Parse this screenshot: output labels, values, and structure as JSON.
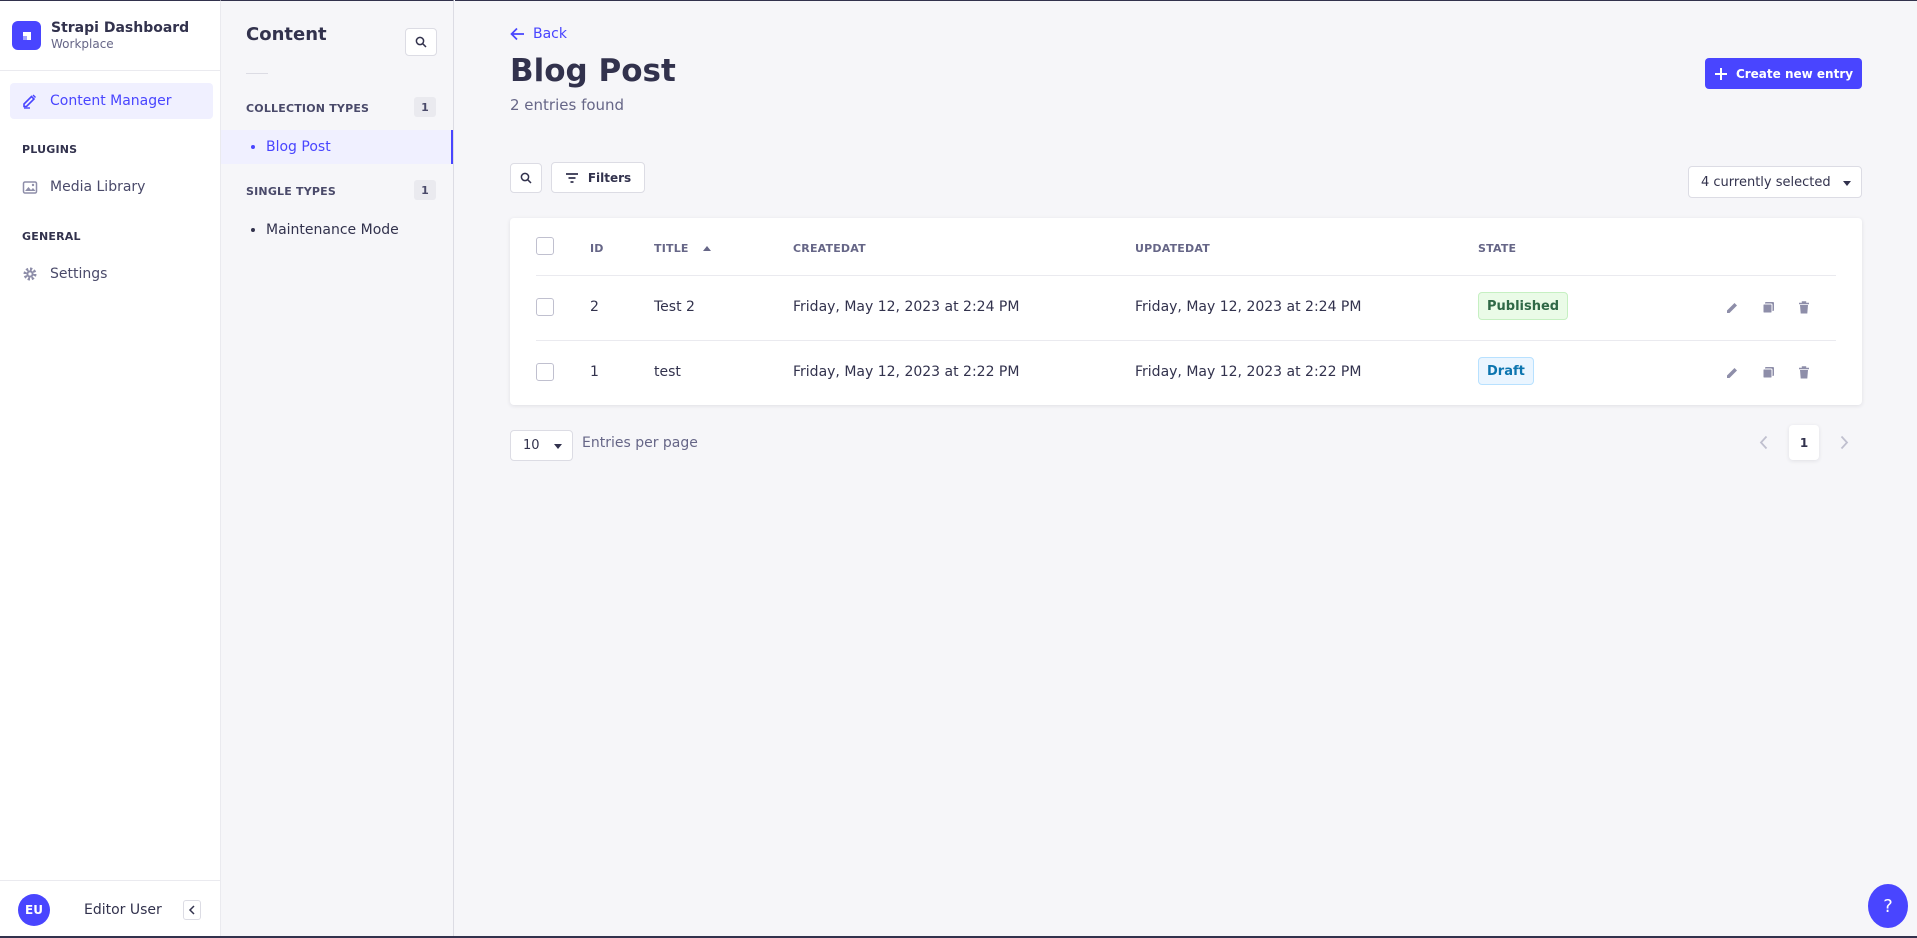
{
  "brand": {
    "title": "Strapi Dashboard",
    "subtitle": "Workplace"
  },
  "leftnav": {
    "content_manager": "Content Manager",
    "plugins_section": "PLUGINS",
    "media_library": "Media Library",
    "general_section": "GENERAL",
    "settings": "Settings"
  },
  "user": {
    "initials": "EU",
    "name": "Editor User"
  },
  "subnav": {
    "title": "Content",
    "collection_types": {
      "label": "COLLECTION TYPES",
      "count": "1",
      "items": [
        "Blog Post"
      ]
    },
    "single_types": {
      "label": "SINGLE TYPES",
      "count": "1",
      "items": [
        "Maintenance Mode"
      ]
    }
  },
  "header": {
    "back": "Back",
    "title": "Blog Post",
    "subtitle": "2 entries found",
    "create_button": "Create new entry"
  },
  "toolbar": {
    "filters": "Filters",
    "columns_selected": "4 currently selected"
  },
  "table": {
    "columns": [
      "ID",
      "TITLE",
      "CREATEDAT",
      "UPDATEDAT",
      "STATE"
    ],
    "rows": [
      {
        "id": "2",
        "title": "Test 2",
        "created": "Friday, May 12, 2023 at 2:24 PM",
        "updated": "Friday, May 12, 2023 at 2:24 PM",
        "state": "Published"
      },
      {
        "id": "1",
        "title": "test",
        "created": "Friday, May 12, 2023 at 2:22 PM",
        "updated": "Friday, May 12, 2023 at 2:22 PM",
        "state": "Draft"
      }
    ]
  },
  "pagination": {
    "page_size": "10",
    "per_page_label": "Entries per page",
    "current_page": "1"
  },
  "help": {
    "label": "?"
  },
  "colors": {
    "primary": "#4945ff",
    "published_text": "#2f6846",
    "draft_text": "#0c75af"
  },
  "icons": [
    "strapi-logo-icon",
    "pencil-icon",
    "image-icon",
    "gear-icon",
    "search-icon",
    "arrow-left-icon",
    "plus-icon",
    "filter-icon",
    "caret-down-icon",
    "sort-up-icon",
    "edit-icon",
    "duplicate-icon",
    "trash-icon",
    "chevron-left-icon",
    "chevron-right-icon"
  ]
}
